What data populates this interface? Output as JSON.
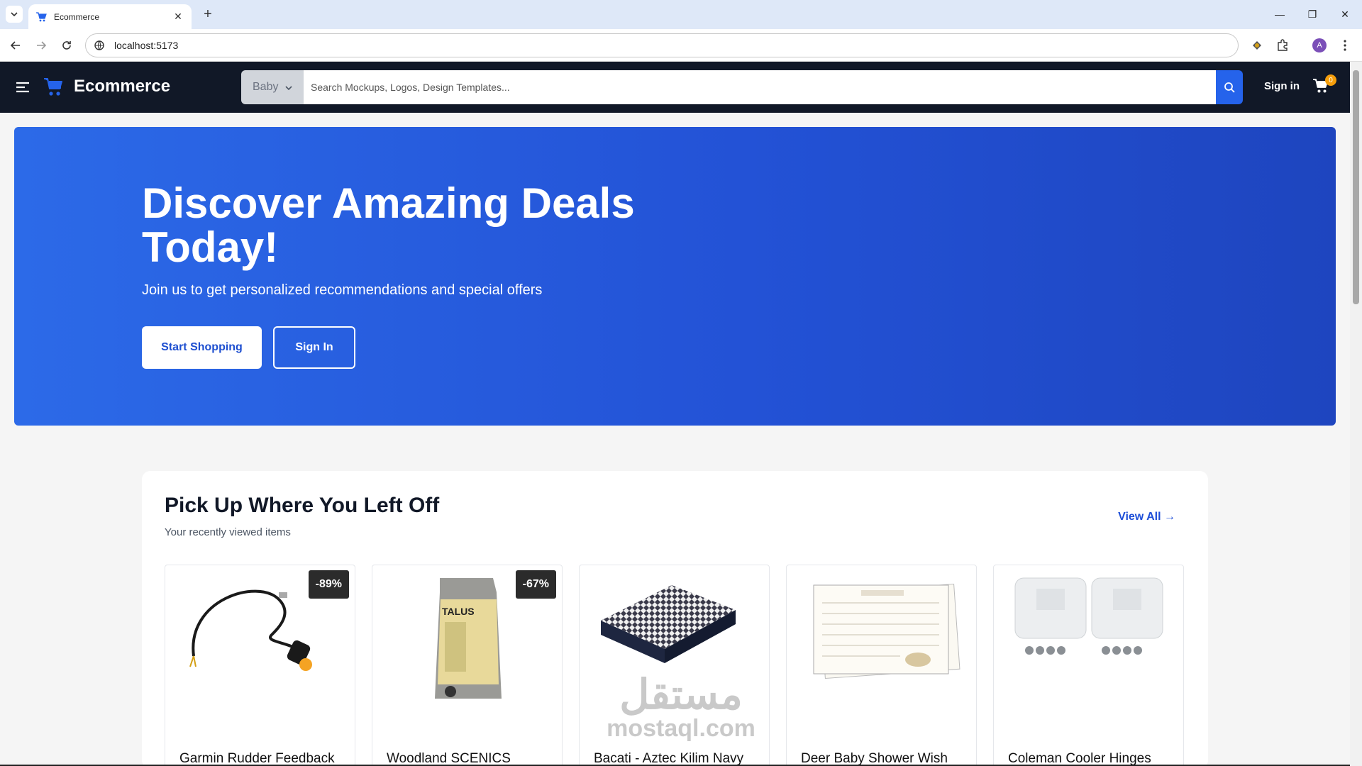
{
  "browser": {
    "tab_title": "Ecommerce",
    "url": "localhost:5173",
    "avatar_letter": "A"
  },
  "header": {
    "brand": "Ecommerce",
    "category": "Baby",
    "search_placeholder": "Search Mockups, Logos, Design Templates...",
    "signin": "Sign in",
    "cart_count": "0"
  },
  "hero": {
    "title": "Discover Amazing Deals Today!",
    "subtitle": "Join us to get personalized recommendations and special offers",
    "primary_button": "Start Shopping",
    "secondary_button": "Sign In"
  },
  "recent": {
    "title": "Pick Up Where You Left Off",
    "subtitle": "Your recently viewed items",
    "view_all": "View All →",
    "items": [
      {
        "title": "Garmin Rudder Feedback",
        "discount": "-89%",
        "icon": "cable-product-image"
      },
      {
        "title": "Woodland SCENICS",
        "discount": "-67%",
        "icon": "ballast-bag-product-image"
      },
      {
        "title": "Bacati - Aztec Kilim Navy",
        "discount": "",
        "icon": "crib-mattress-product-image"
      },
      {
        "title": "Deer Baby Shower Wish",
        "discount": "",
        "icon": "wish-cards-product-image"
      },
      {
        "title": "Coleman Cooler Hinges",
        "discount": "",
        "icon": "hinges-product-image"
      }
    ]
  },
  "watermark": {
    "arabic": "مستقل",
    "latin": "mostaql.com"
  },
  "colors": {
    "header_bg": "#111827",
    "accent": "#2563eb",
    "hero_start": "#2c6ae8",
    "hero_end": "#1e45bf"
  }
}
